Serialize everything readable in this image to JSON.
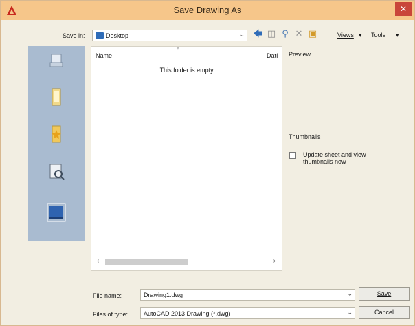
{
  "window": {
    "title": "Save Drawing As",
    "close_icon": "close-icon"
  },
  "toolbar": {
    "save_in_label": "Save in:",
    "save_in_value": "Desktop",
    "views_label": "Views",
    "tools_label": "Tools"
  },
  "file_list": {
    "col_name": "Name",
    "col_date": "Datí",
    "empty_message": "This folder is empty."
  },
  "preview": {
    "label": "Preview",
    "thumbnails_label": "Thumbnails",
    "update_checkbox_label": "Update sheet and view thumbnails now"
  },
  "bottom": {
    "file_name_label": "File name:",
    "file_name_value": "Drawing1.dwg",
    "file_type_label": "Files of type:",
    "file_type_value": "AutoCAD 2013 Drawing (*.dwg)",
    "save_button": "Save",
    "cancel_button": "Cancel"
  },
  "colors": {
    "titlebar": "#f6c68a",
    "places_bar": "#a9bbd0",
    "close": "#c9453a"
  }
}
